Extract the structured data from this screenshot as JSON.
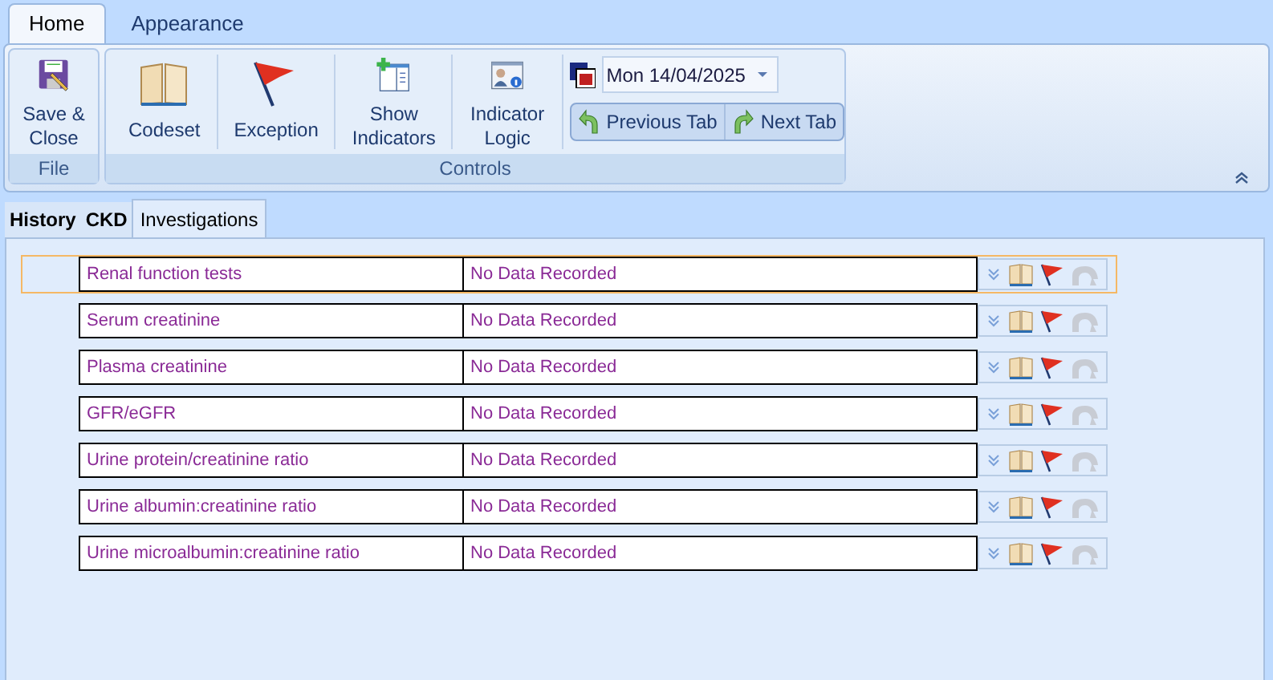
{
  "ribbon_tabs": [
    {
      "label": "Home",
      "selected": true
    },
    {
      "label": "Appearance",
      "selected": false
    }
  ],
  "ribbon_groups": [
    {
      "label": "File",
      "buttons": [
        {
          "kind": "save",
          "label": "Save & Close"
        }
      ]
    },
    {
      "label": "Controls",
      "buttons": [
        {
          "kind": "book",
          "label": "Codeset"
        },
        {
          "kind": "flag",
          "label": "Exception"
        },
        {
          "kind": "indicators",
          "label": "Show Indicators"
        },
        {
          "kind": "logic",
          "label": "Indicator Logic"
        }
      ],
      "date": {
        "value": "Mon 14/04/2025"
      },
      "nav_buttons": [
        {
          "kind": "prev",
          "label": "Previous Tab"
        },
        {
          "kind": "next",
          "label": "Next Tab"
        }
      ]
    }
  ],
  "page_tabs": [
    {
      "label": "History",
      "selected": false
    },
    {
      "label": "CKD",
      "selected": false
    },
    {
      "label": "Investigations",
      "selected": true
    }
  ],
  "rows": [
    {
      "label": "Renal function tests",
      "value": "No Data Recorded",
      "selected": true
    },
    {
      "label": "Serum creatinine",
      "value": "No Data Recorded",
      "selected": false
    },
    {
      "label": "Plasma creatinine",
      "value": "No Data Recorded",
      "selected": false
    },
    {
      "label": "GFR/eGFR",
      "value": "No Data Recorded",
      "selected": false
    },
    {
      "label": "Urine protein/creatinine ratio",
      "value": "No Data Recorded",
      "selected": false
    },
    {
      "label": "Urine albumin:creatinine ratio",
      "value": "No Data Recorded",
      "selected": false
    },
    {
      "label": "Urine microalbumin:creatinine ratio",
      "value": "No Data Recorded",
      "selected": false
    }
  ]
}
